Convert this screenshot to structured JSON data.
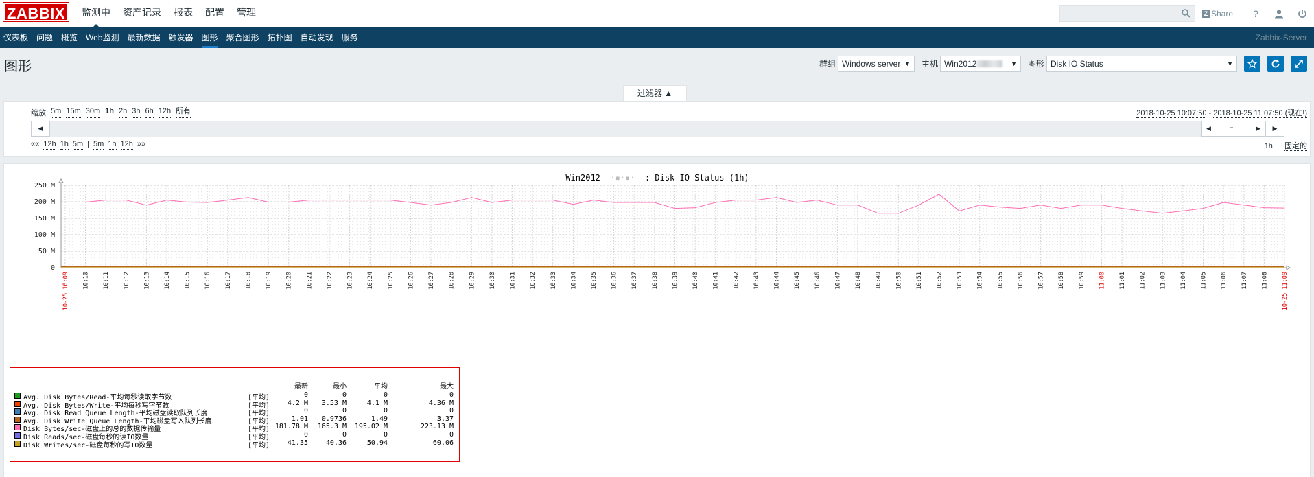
{
  "header": {
    "logo": "ZABBIX",
    "main_menu": [
      "监测中",
      "资产记录",
      "报表",
      "配置",
      "管理"
    ],
    "active_main": "监测中",
    "search_placeholder": "",
    "share_label": "Share",
    "help_icon": "question-icon",
    "user_icon": "user-icon",
    "logout_icon": "power-icon"
  },
  "subnav": {
    "items": [
      "仪表板",
      "问题",
      "概览",
      "Web监测",
      "最新数据",
      "触发器",
      "图形",
      "聚合图形",
      "拓扑图",
      "自动发现",
      "服务"
    ],
    "active": "图形",
    "server_name": "Zabbix-Server"
  },
  "page": {
    "title": "图形",
    "group_label": "群组",
    "group_value": "Windows server",
    "host_label": "主机",
    "host_value": "Win2012",
    "graph_label": "图形",
    "graph_value": "Disk IO Status"
  },
  "filter": {
    "tab_label": "过滤器 ▲",
    "zoom_label": "缩放:",
    "zoom_options": [
      "5m",
      "15m",
      "30m",
      "1h",
      "2h",
      "3h",
      "6h",
      "12h",
      "所有"
    ],
    "zoom_current": "1h",
    "range_start": "2018-10-25 10:07:50",
    "range_sep": " - ",
    "range_end": "2018-10-25 11:07:50 (现在!)",
    "nav_back": [
      "««",
      "12h",
      "1h",
      "5m",
      "|",
      "5m",
      "1h",
      "12h",
      "»»"
    ],
    "period": "1h",
    "fixed_label": "固定的"
  },
  "chart_data": {
    "type": "line",
    "title": "Win2012",
    "title_suffix": ": Disk IO Status  (1h)",
    "y_ticks": [
      "250 M",
      "200 M",
      "150 M",
      "100 M",
      "50 M",
      "0"
    ],
    "ylim": [
      0,
      250
    ],
    "grid": true,
    "x_start_label": "10-25 10:09",
    "x_end_label": "10-25 11:09",
    "x_minutes": [
      "10:10",
      "10:11",
      "10:12",
      "10:13",
      "10:14",
      "10:15",
      "10:16",
      "10:17",
      "10:18",
      "10:19",
      "10:20",
      "10:21",
      "10:22",
      "10:23",
      "10:24",
      "10:25",
      "10:26",
      "10:27",
      "10:28",
      "10:29",
      "10:30",
      "10:31",
      "10:32",
      "10:33",
      "10:34",
      "10:35",
      "10:36",
      "10:37",
      "10:38",
      "10:39",
      "10:40",
      "10:41",
      "10:42",
      "10:43",
      "10:44",
      "10:45",
      "10:46",
      "10:47",
      "10:48",
      "10:49",
      "10:50",
      "10:51",
      "10:52",
      "10:53",
      "10:54",
      "10:55",
      "10:56",
      "10:57",
      "10:58",
      "10:59",
      "11:00",
      "11:01",
      "11:02",
      "11:03",
      "11:04",
      "11:05",
      "11:06",
      "11:07",
      "11:08"
    ],
    "series": [
      {
        "name": "Disk Bytes/sec-磁盘上的总的数据传输量",
        "color": "#ff6eb4",
        "x": [
          0,
          1,
          2,
          3,
          4,
          5,
          6,
          7,
          8,
          9,
          10,
          11,
          12,
          13,
          14,
          15,
          16,
          17,
          18,
          19,
          20,
          21,
          22,
          23,
          24,
          25,
          26,
          27,
          28,
          29,
          30,
          31,
          32,
          33,
          34,
          35,
          36,
          37,
          38,
          39,
          40,
          41,
          42,
          43,
          44,
          45,
          46,
          47,
          48,
          49,
          50,
          51,
          52,
          53,
          54,
          55,
          56,
          57,
          58,
          59,
          60
        ],
        "values": [
          199,
          199,
          205,
          205,
          190,
          205,
          199,
          198,
          205,
          213,
          199,
          199,
          205,
          205,
          205,
          205,
          205,
          198,
          190,
          198,
          213,
          198,
          205,
          205,
          205,
          192,
          205,
          198,
          198,
          198,
          180,
          182,
          198,
          205,
          205,
          213,
          198,
          205,
          190,
          190,
          165,
          165,
          190,
          223,
          172,
          190,
          184,
          180,
          190,
          180,
          190,
          190,
          180,
          172,
          165,
          172,
          180,
          198,
          190,
          182,
          181
        ]
      },
      {
        "name": "Avg. Disk Write Queue Length-平均磁盘写入队列长度",
        "color": "#b5651d",
        "values_flat": 3
      },
      {
        "name": "Disk Writes/sec-磁盘每秒的写IO数量",
        "color": "#c8a028",
        "values_flat": 0.04
      }
    ]
  },
  "legend": {
    "headers": [
      "最新",
      "最小",
      "平均",
      "最大"
    ],
    "rows": [
      {
        "color": "#1a9c1a",
        "name": "Avg. Disk Bytes/Read-平均每秒读取字节数",
        "func": "[平均]",
        "last": "0",
        "min": "0",
        "avg": "0",
        "max": "0"
      },
      {
        "color": "#ee4400",
        "name": "Avg. Disk Bytes/Write-平均每秒写字节数",
        "func": "[平均]",
        "last": "4.2 M",
        "min": "3.53 M",
        "avg": "4.1 M",
        "max": "4.36 M"
      },
      {
        "color": "#3a7fb5",
        "name": "Avg. Disk Read Queue Length-平均磁盘读取队列长度",
        "func": "[平均]",
        "last": "0",
        "min": "0",
        "avg": "0",
        "max": "0"
      },
      {
        "color": "#b5651d",
        "name": "Avg. Disk Write Queue Length-平均磁盘写入队列长度",
        "func": "[平均]",
        "last": "1.01",
        "min": "0.9736",
        "avg": "1.49",
        "max": "3.37"
      },
      {
        "color": "#ff6eb4",
        "name": "Disk Bytes/sec-磁盘上的总的数据传输量",
        "func": "[平均]",
        "last": "181.78 M",
        "min": "165.3 M",
        "avg": "195.02 M",
        "max": "223.13 M"
      },
      {
        "color": "#7070e0",
        "name": "Disk Reads/sec-磁盘每秒的读IO数量",
        "func": "[平均]",
        "last": "0",
        "min": "0",
        "avg": "0",
        "max": "0"
      },
      {
        "color": "#c8a028",
        "name": "Disk Writes/sec-磁盘每秒的写IO数量",
        "func": "[平均]",
        "last": "41.35",
        "min": "40.36",
        "avg": "50.94",
        "max": "60.06"
      }
    ]
  }
}
